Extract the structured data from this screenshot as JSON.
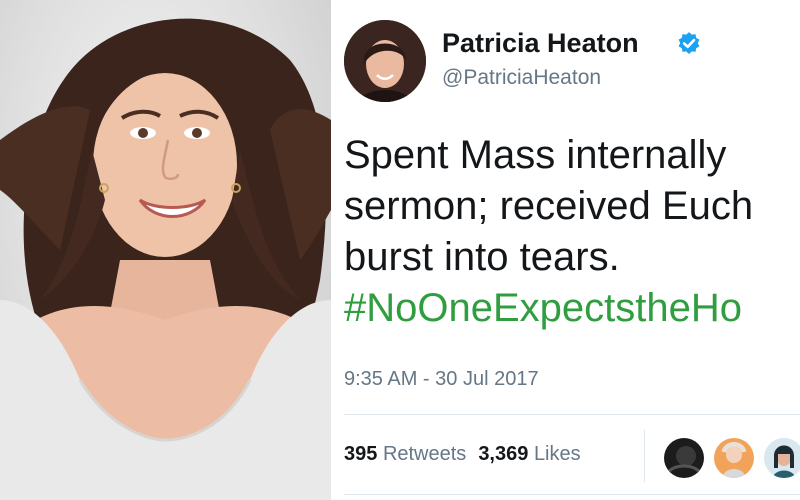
{
  "tweet": {
    "display_name": "Patricia Heaton",
    "handle": "@PatriciaHeaton",
    "text_lines": [
      "Spent Mass internally",
      "sermon; received Euch",
      "burst into tears."
    ],
    "hashtag": "#NoOneExpectstheHo",
    "timestamp": "9:35 AM - 30 Jul 2017",
    "retweets_count": "395",
    "retweets_label": "Retweets",
    "likes_count": "3,369",
    "likes_label": "Likes"
  },
  "icons": {
    "verified": "verified-badge-icon"
  },
  "colors": {
    "hashtag": "#2f9e3f",
    "verified": "#1da1f2",
    "secondary_text": "#657786",
    "primary_text": "#14171a"
  }
}
